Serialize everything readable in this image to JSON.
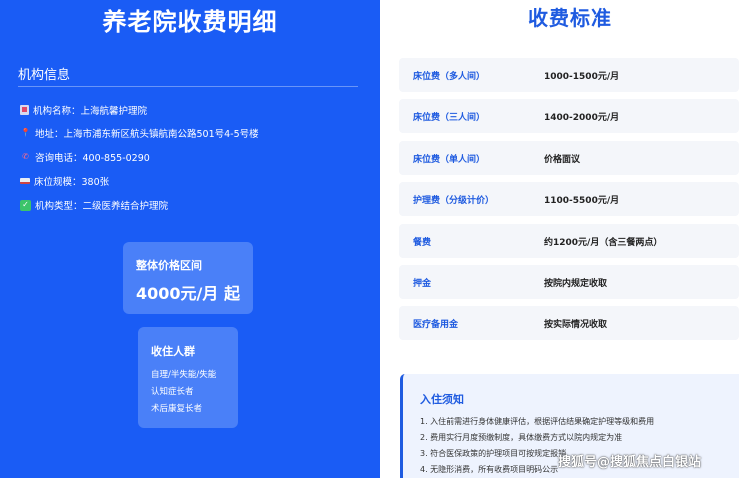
{
  "left": {
    "title": "养老院收费明细",
    "section_title": "机构信息",
    "info": [
      {
        "icon": "building-icon",
        "text": "机构名称：上海航馨护理院"
      },
      {
        "icon": "pin-icon",
        "text": "地址：上海市浦东新区航头镇航南公路501号4-5号楼"
      },
      {
        "icon": "phone-icon",
        "text": "咨询电话：400-855-0290"
      },
      {
        "icon": "bed-icon",
        "text": "床位规模：380张"
      },
      {
        "icon": "check-icon",
        "text": "机构类型：二级医养结合护理院"
      }
    ],
    "price_card": {
      "label": "整体价格区间",
      "value": "4000元/月 起"
    },
    "crowd_card": {
      "title": "收住人群",
      "lines": [
        "自理/半失能/失能",
        "认知症长者",
        "术后康复长者"
      ]
    }
  },
  "right": {
    "title": "收费标准",
    "fees": [
      {
        "name": "床位费（多人间）",
        "value": "1000-1500元/月"
      },
      {
        "name": "床位费（三人间）",
        "value": "1400-2000元/月"
      },
      {
        "name": "床位费（单人间）",
        "value": "价格面议"
      },
      {
        "name": "护理费（分级计价）",
        "value": "1100-5500元/月"
      },
      {
        "name": "餐费",
        "value": "约1200元/月（含三餐两点）"
      },
      {
        "name": "押金",
        "value": "按院内规定收取"
      },
      {
        "name": "医疗备用金",
        "value": "按实际情况收取"
      }
    ],
    "notice": {
      "title": "入住须知",
      "lines": [
        "1. 入住前需进行身体健康评估，根据评估结果确定护理等级和费用",
        "2. 费用实行月度预缴制度，具体缴费方式以院内规定为准",
        "3. 符合医保政策的护理项目可按规定报销",
        "4. 无隐形消费，所有收费项目明码公示"
      ]
    }
  },
  "watermark": "搜狐号@搜狐焦点白银站",
  "colors": {
    "primary": "#1a5cf5",
    "card": "#4a80f8",
    "accent": "#1f5be0"
  }
}
